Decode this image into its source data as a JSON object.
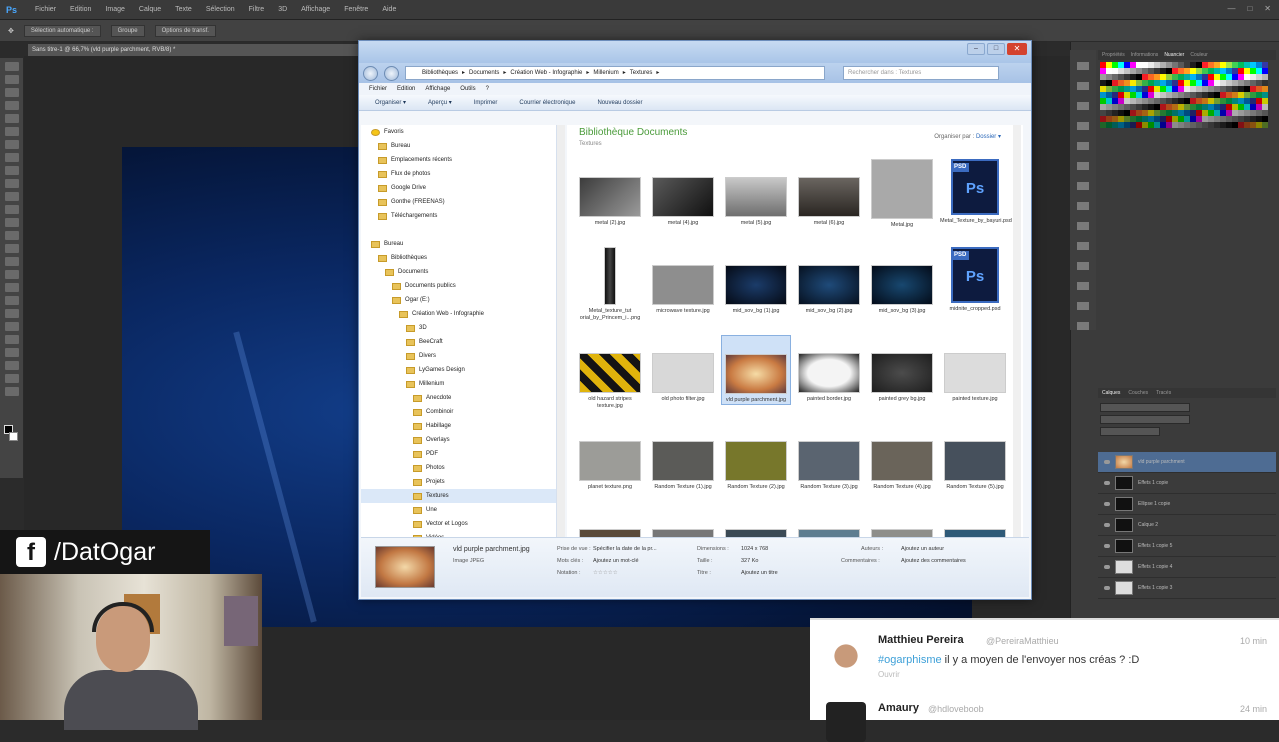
{
  "photoshop": {
    "logo": "Ps",
    "menu": [
      "Fichier",
      "Edition",
      "Image",
      "Calque",
      "Texte",
      "Sélection",
      "Filtre",
      "3D",
      "Affichage",
      "Fenêtre",
      "Aide"
    ],
    "options": [
      "Sélection automatique :",
      "Groupe",
      "Options de transf."
    ],
    "doc_tab": "Sans titre-1 @ 66,7% (vld purple parchment, RVB/8) *",
    "swatch_tabs": [
      "Propriétés",
      "Informations",
      "Nuancier",
      "Couleur"
    ],
    "layer_tabs": [
      "Calques",
      "Couches",
      "Tracés"
    ],
    "swatch_colors": [
      "#ff0000",
      "#ffff00",
      "#00ff00",
      "#00ffff",
      "#0000ff",
      "#ff00ff",
      "#ffffff",
      "#e6e6e6",
      "#cccccc",
      "#b3b3b3",
      "#999999",
      "#808080",
      "#666666",
      "#4d4d4d",
      "#333333",
      "#1a1a1a",
      "#000000",
      "#ed1c24",
      "#f26522",
      "#f7941d",
      "#fff200",
      "#8dc63f",
      "#39b54a",
      "#00a651",
      "#00a99d",
      "#00aeef",
      "#0072bc",
      "#2e3192"
    ],
    "layers": [
      {
        "name": "vld purple parchment",
        "selected": true
      },
      {
        "name": "Effets 1 copie",
        "selected": false
      },
      {
        "name": "Ellipse 1 copie",
        "selected": false
      },
      {
        "name": "Calque 2",
        "selected": false
      },
      {
        "name": "Effets 1 copie 5",
        "selected": false
      },
      {
        "name": "Effets 1 copie 4",
        "selected": false
      },
      {
        "name": "Effets 1 copie 3",
        "selected": false
      }
    ]
  },
  "explorer": {
    "breadcrumb": [
      "Bibliothèques",
      "Documents",
      "Création Web - Infographie",
      "Millenium",
      "Textures"
    ],
    "search_placeholder": "Rechercher dans : Textures",
    "menu": [
      "Fichier",
      "Edition",
      "Affichage",
      "Outils",
      "?"
    ],
    "commands": [
      "Organiser ▾",
      "Aperçu ▾",
      "Imprimer",
      "Courrier électronique",
      "Nouveau dossier"
    ],
    "nav": [
      {
        "label": "Favoris",
        "indent": 0,
        "type": "star"
      },
      {
        "label": "Bureau",
        "indent": 1
      },
      {
        "label": "Emplacements récents",
        "indent": 1
      },
      {
        "label": "Flux de photos",
        "indent": 1
      },
      {
        "label": "Google Drive",
        "indent": 1
      },
      {
        "label": "Gonthe (FREENAS)",
        "indent": 1
      },
      {
        "label": "Téléchargements",
        "indent": 1
      },
      {
        "label": "",
        "indent": 0
      },
      {
        "label": "Bureau",
        "indent": 0
      },
      {
        "label": "Bibliothèques",
        "indent": 1
      },
      {
        "label": "Documents",
        "indent": 2
      },
      {
        "label": "Documents publics",
        "indent": 3
      },
      {
        "label": "Ogar (E:)",
        "indent": 3
      },
      {
        "label": "Création Web - Infographie",
        "indent": 4
      },
      {
        "label": "3D",
        "indent": 5
      },
      {
        "label": "BeeCraft",
        "indent": 5
      },
      {
        "label": "Divers",
        "indent": 5
      },
      {
        "label": "LyGames Design",
        "indent": 5
      },
      {
        "label": "Millenium",
        "indent": 5
      },
      {
        "label": "Anecdote",
        "indent": 6
      },
      {
        "label": "Combinoir",
        "indent": 6
      },
      {
        "label": "Habillage",
        "indent": 6
      },
      {
        "label": "Overlays",
        "indent": 6
      },
      {
        "label": "PDF",
        "indent": 6
      },
      {
        "label": "Photos",
        "indent": 6
      },
      {
        "label": "Projets",
        "indent": 6
      },
      {
        "label": "Textures",
        "indent": 6,
        "selected": true
      },
      {
        "label": "Une",
        "indent": 6
      },
      {
        "label": "Vector et Logos",
        "indent": 6
      },
      {
        "label": "Vidéos",
        "indent": 6
      }
    ],
    "library_title": "Bibliothèque Documents",
    "library_sub": "Textures",
    "arrange_label": "Organiser par :",
    "arrange_value": "Dossier ▾",
    "files": [
      {
        "name": "metal (2).jpg",
        "bg": "linear-gradient(135deg,#3c3c3c,#9a9a9a)"
      },
      {
        "name": "metal (4).jpg",
        "bg": "linear-gradient(135deg,#5a5a5a,#101010)"
      },
      {
        "name": "metal (5).jpg",
        "bg": "linear-gradient(#c8c8c8,#6e6e6e)"
      },
      {
        "name": "metal (6).jpg",
        "bg": "linear-gradient(#6a6560,#2a2622)"
      },
      {
        "name": "Metal.jpg",
        "bg": "#a9a9a9"
      },
      {
        "name": "Metal_Texture_by_bayuri.psd",
        "psd": true
      },
      {
        "name": "Metal_texture_tut orial_by_Princem_i...png",
        "bg": "linear-gradient(90deg,#111,#444,#111)"
      },
      {
        "name": "microwave texture.jpg",
        "bg": "#8e8e8e"
      },
      {
        "name": "mid_sov_bg (1).jpg",
        "bg": "radial-gradient(#1b3c6a,#050a15)"
      },
      {
        "name": "mid_sov_bg (2).jpg",
        "bg": "radial-gradient(#1f4b7a,#06101f)"
      },
      {
        "name": "mid_sov_bg (3).jpg",
        "bg": "radial-gradient(#184870,#030b18)"
      },
      {
        "name": "midnite_cropped.psd",
        "psd": true
      },
      {
        "name": "old hazard stripes texture.jpg",
        "bg": "repeating-linear-gradient(45deg,#e0b40c 0 8px,#141414 8px 16px)"
      },
      {
        "name": "old photo filter.jpg",
        "bg": "#d8d8d8"
      },
      {
        "name": "vld purple parchment.jpg",
        "bg": "radial-gradient(#f6dca6,#c97a42 60%,#5e3b3f)",
        "selected": true
      },
      {
        "name": "painted border.jpg",
        "bg": "radial-gradient(#f4f4f4 50%,#222)"
      },
      {
        "name": "painted grey bg.jpg",
        "bg": "radial-gradient(#4c4c4c,#1e1e1e)"
      },
      {
        "name": "painted texture.jpg",
        "bg": "#dcdcdc"
      },
      {
        "name": "planet texture.png",
        "bg": "#9c9c98"
      },
      {
        "name": "Random Texture (1).jpg",
        "bg": "#5b5b58"
      },
      {
        "name": "Random Texture (2).jpg",
        "bg": "#77772b"
      },
      {
        "name": "Random Texture (3).jpg",
        "bg": "#5a6470"
      },
      {
        "name": "Random Texture (4).jpg",
        "bg": "#6a645a"
      },
      {
        "name": "Random Texture (5).jpg",
        "bg": "#46505c"
      },
      {
        "name": "",
        "bg": "#5a4a3a"
      },
      {
        "name": "",
        "bg": "#777"
      },
      {
        "name": "",
        "bg": "#3b4a55"
      },
      {
        "name": "",
        "bg": "#5e7d90"
      },
      {
        "name": "",
        "bg": "#8e8e8a"
      },
      {
        "name": "",
        "bg": "#2e5a78"
      }
    ],
    "details": {
      "filename": "vld purple parchment.jpg",
      "type": "Image JPEG",
      "date_label": "Prise de vue :",
      "date_value": "Spécifier la date de la pr...",
      "rating_label": "Notation :",
      "rating_value": "☆☆☆☆☆",
      "keywords_label": "Mots clés :",
      "keywords_value": "Ajoutez un mot-clé",
      "dims_label": "Dimensions :",
      "dims_value": "1024 x 768",
      "size_label": "Taille :",
      "size_value": "327 Ko",
      "title_label": "Titre :",
      "title_value": "Ajoutez un titre",
      "authors_label": "Auteurs :",
      "authors_value": "Ajoutez un auteur",
      "comments_label": "Commentaires :",
      "comments_value": "Ajoutez des commentaires"
    }
  },
  "stream": {
    "facebook_text": "/DatOgar",
    "facebook_icon": "f"
  },
  "tweets": [
    {
      "name": "Matthieu Pereira",
      "handle": "@PereiraMatthieu",
      "time": "10 min",
      "hashtag": "#ogarphisme",
      "text": " il y a moyen de l'envoyer nos créas ? :D",
      "sub": "Ouvrir"
    },
    {
      "name": "Amaury",
      "handle": "@hdloveboob",
      "time": "24 min"
    }
  ]
}
